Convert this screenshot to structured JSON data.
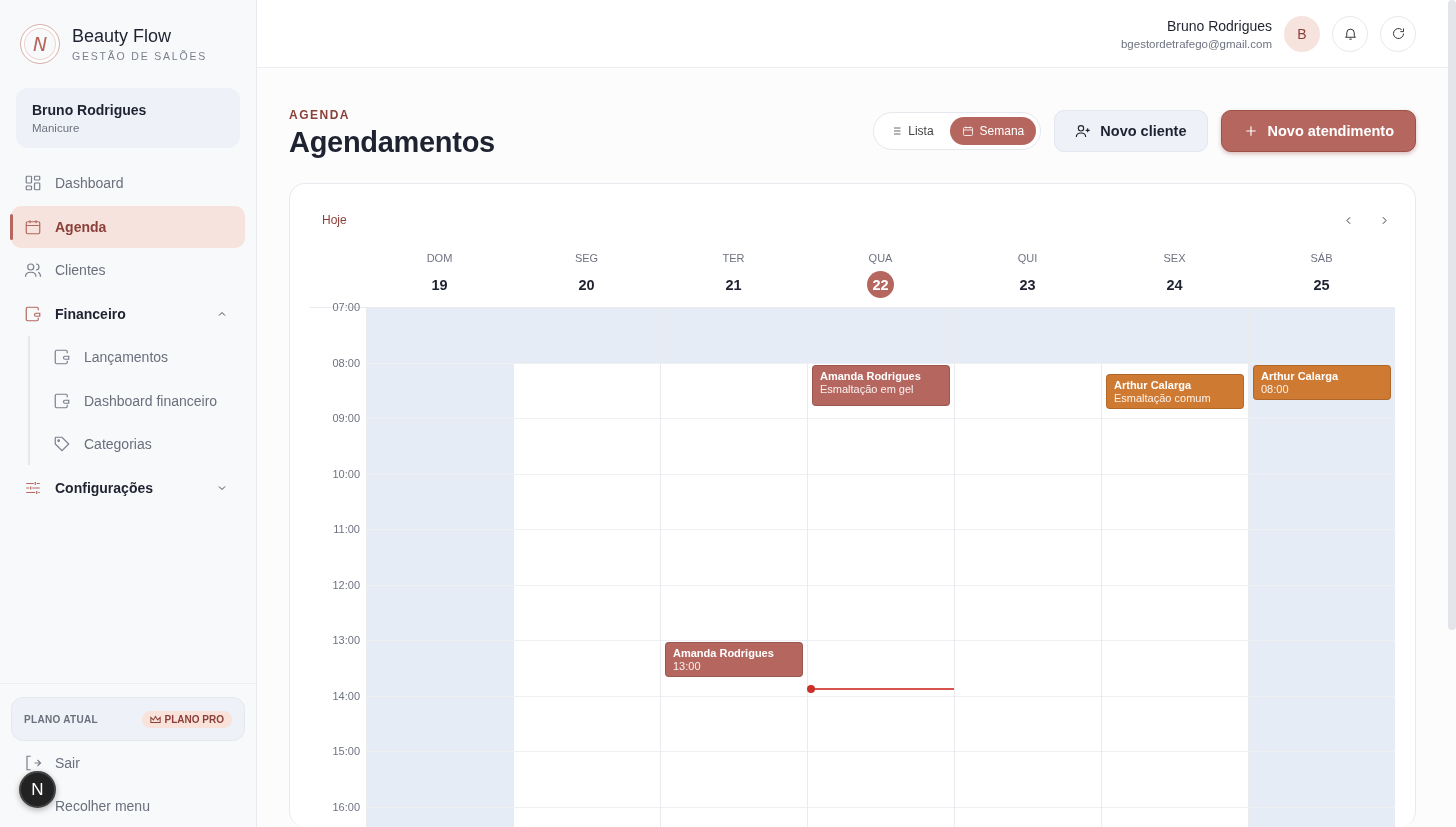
{
  "brand": {
    "logo_letter": "N",
    "name": "Beauty Flow",
    "tagline": "GESTÃO DE SALÕES"
  },
  "profile_card": {
    "name": "Bruno Rodrigues",
    "role": "Manicure"
  },
  "nav": [
    {
      "label": "Dashboard",
      "selected": false
    },
    {
      "label": "Agenda",
      "selected": true
    },
    {
      "label": "Clientes",
      "selected": false
    },
    {
      "label": "Financeiro",
      "selected": false,
      "expanded": true,
      "children": [
        {
          "label": "Lançamentos",
          "selected": false
        },
        {
          "label": "Dashboard financeiro",
          "selected": false
        },
        {
          "label": "Categorias",
          "selected": false
        }
      ]
    },
    {
      "label": "Configurações",
      "selected": false,
      "expanded": false
    }
  ],
  "plan": {
    "label": "PLANO ATUAL",
    "badge": "PLANO PRO"
  },
  "footer_links": [
    "Sair",
    "Recolher menu"
  ],
  "dev_badge": "N",
  "header": {
    "user_name": "Bruno Rodrigues",
    "user_email": "bgestordetrafego@gmail.com",
    "avatar_letter": "B"
  },
  "page": {
    "eyebrow": "AGENDA",
    "title": "Agendamentos"
  },
  "view_toggle": [
    {
      "label": "Lista",
      "selected": false
    },
    {
      "label": "Semana",
      "selected": true
    }
  ],
  "actions": [
    {
      "label": "Novo cliente",
      "kind": "secondary"
    },
    {
      "label": "Novo atendimento",
      "kind": "primary"
    }
  ],
  "calendar": {
    "today_button": "Hoje",
    "days": [
      {
        "weekday": "DOM",
        "date": "19",
        "today": false,
        "closed": true
      },
      {
        "weekday": "SEG",
        "date": "20",
        "today": false,
        "closed": false
      },
      {
        "weekday": "TER",
        "date": "21",
        "today": false,
        "closed": false,
        "events": [
          {
            "client": "Amanda Rodrigues",
            "detail": "13:00",
            "color": "#b5675f"
          }
        ]
      },
      {
        "weekday": "QUA",
        "date": "22",
        "today": true,
        "closed": false,
        "events": [
          {
            "client": "Amanda Rodrigues",
            "detail": "Esmaltação em gel",
            "color": "#b5675f"
          }
        ]
      },
      {
        "weekday": "QUI",
        "date": "23",
        "today": false,
        "closed": false
      },
      {
        "weekday": "SEX",
        "date": "24",
        "today": false,
        "closed": false,
        "events": [
          {
            "client": "Arthur Calarga",
            "detail": "Esmaltação comum",
            "color": "#cf7a32"
          }
        ]
      },
      {
        "weekday": "SÁB",
        "date": "25",
        "today": false,
        "closed": true,
        "events": [
          {
            "client": "Arthur Calarga",
            "detail": "08:00",
            "color": "#cf7a32"
          }
        ]
      }
    ],
    "hours": [
      {
        "label": "07:00",
        "closed": true
      },
      {
        "label": "08:00",
        "closed": false
      },
      {
        "label": "09:00",
        "closed": false
      },
      {
        "label": "10:00",
        "closed": false
      },
      {
        "label": "11:00",
        "closed": false
      },
      {
        "label": "12:00",
        "closed": false
      },
      {
        "label": "13:00",
        "closed": false
      },
      {
        "label": "14:00",
        "closed": false
      },
      {
        "label": "15:00",
        "closed": false
      },
      {
        "label": "16:00",
        "closed": false
      }
    ]
  }
}
